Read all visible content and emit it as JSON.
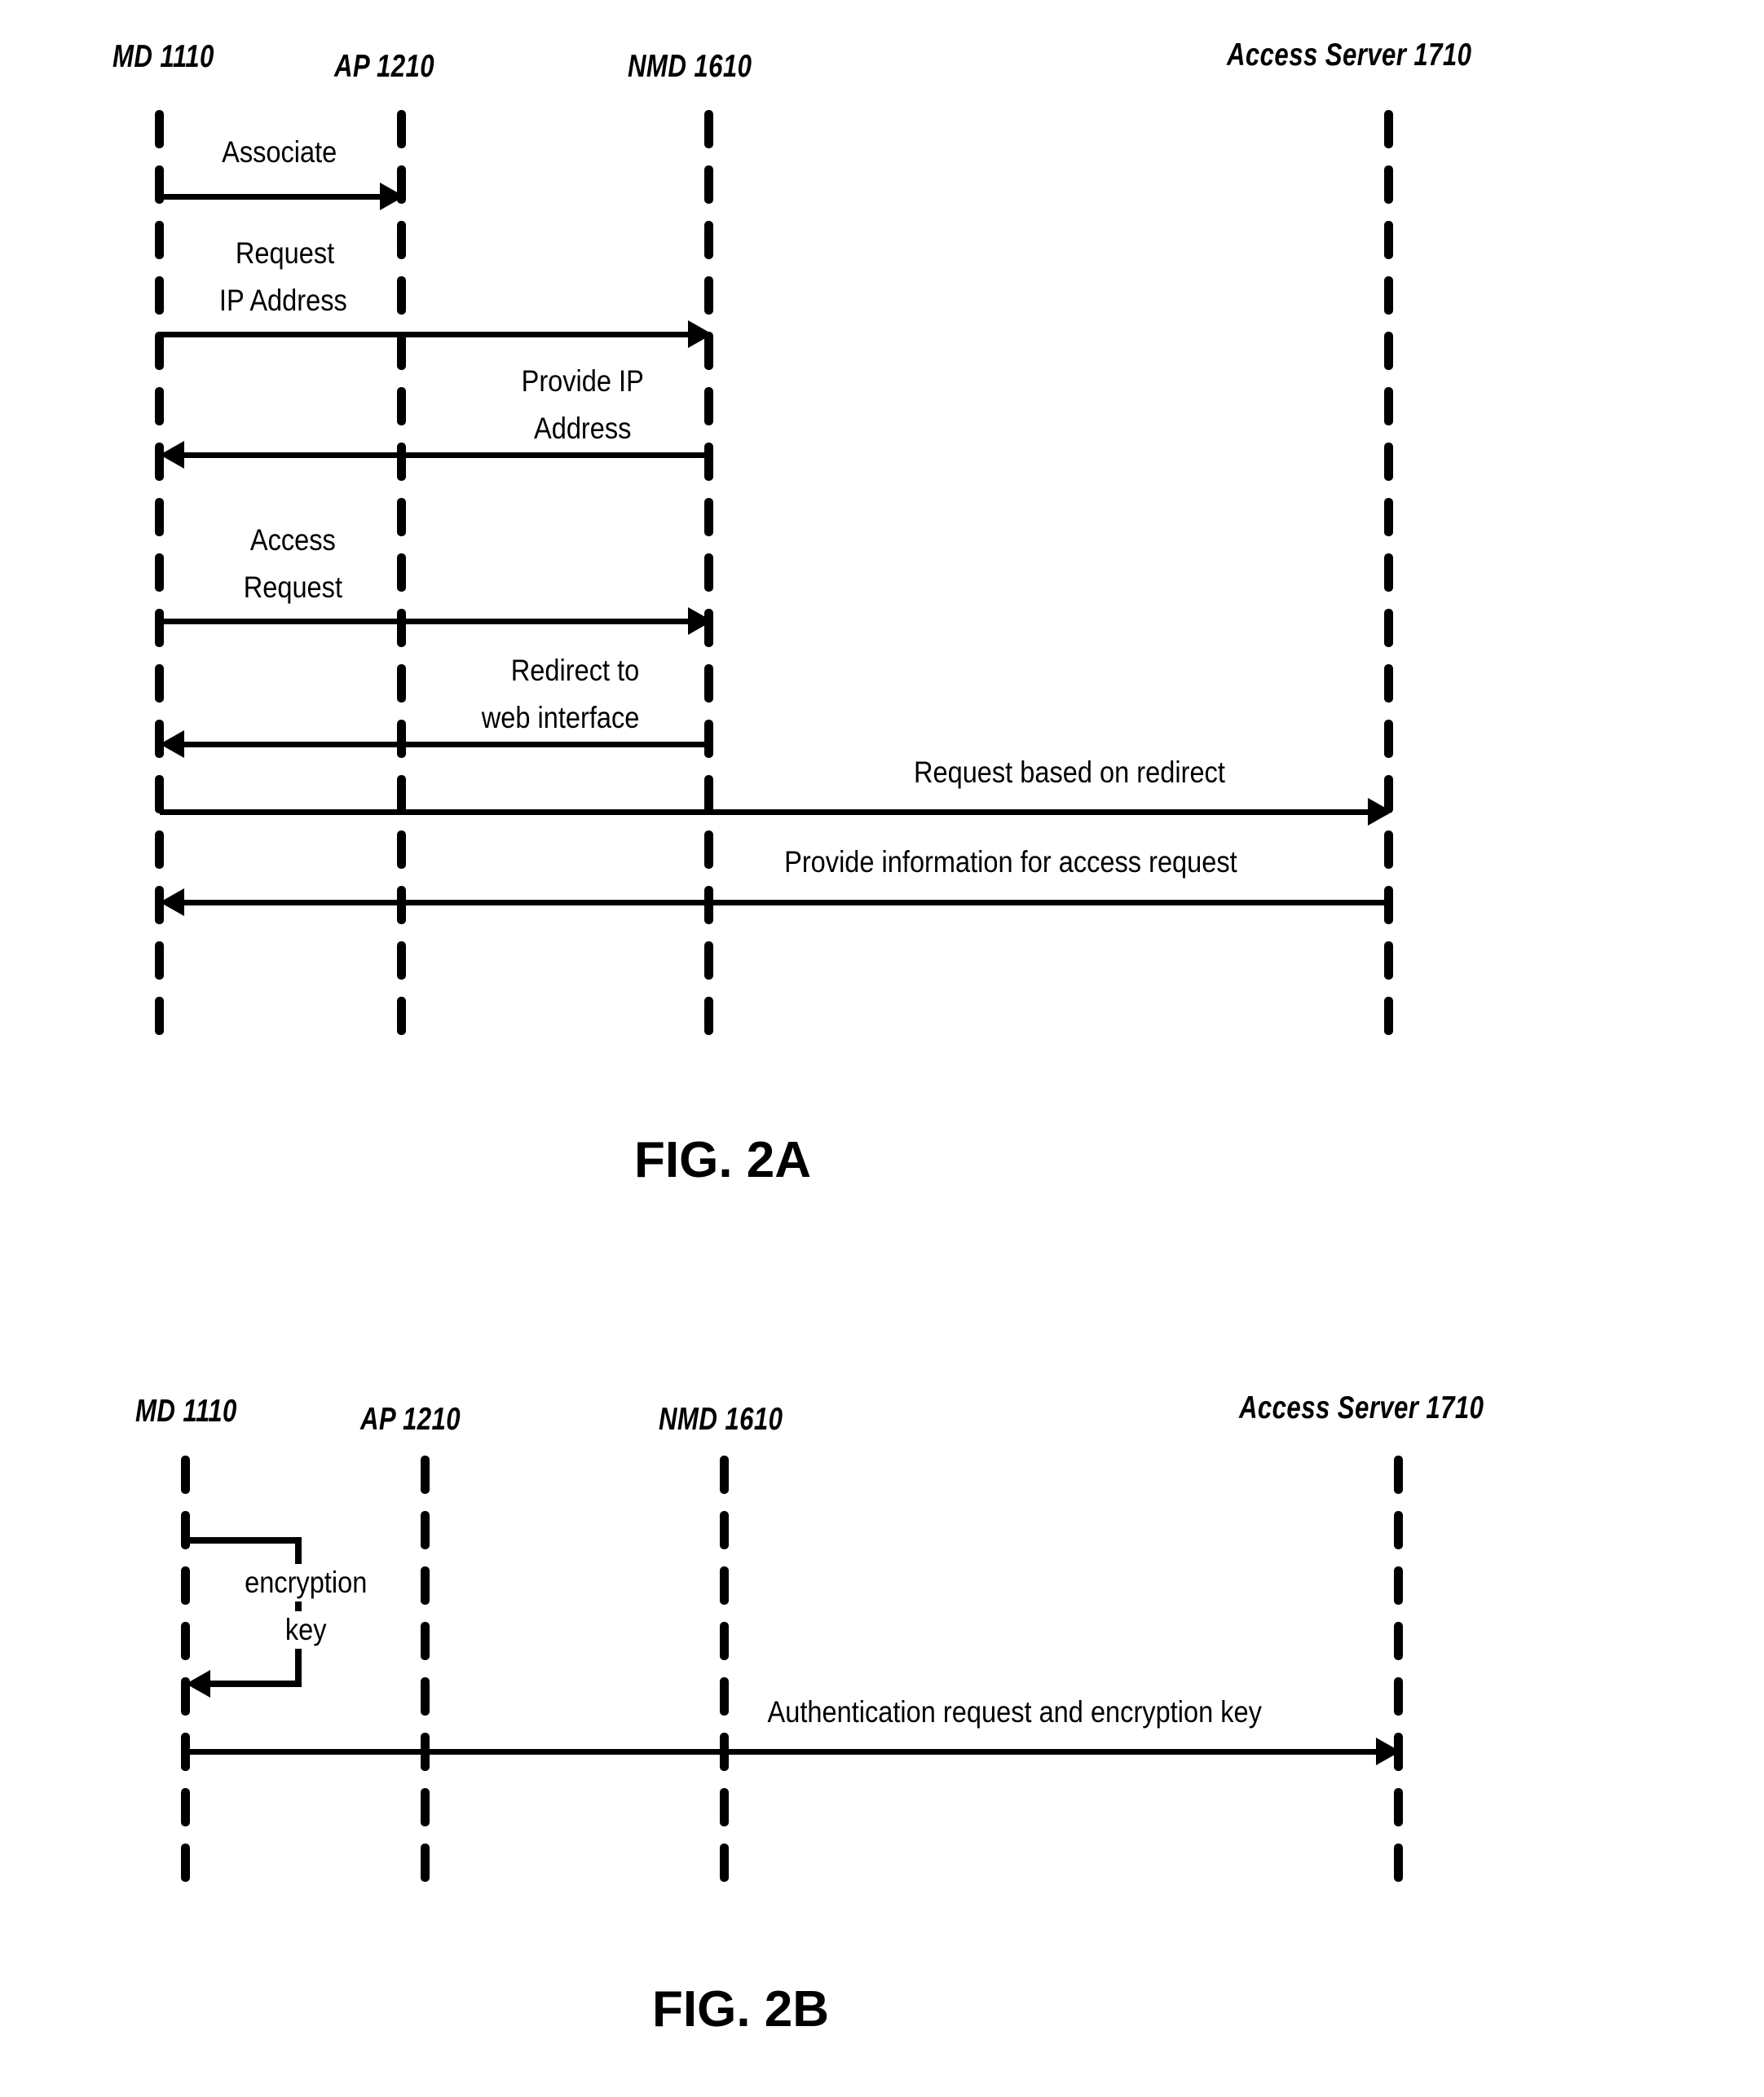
{
  "figures": [
    {
      "id": "fig-2a",
      "caption": "FIG. 2A",
      "participants": [
        {
          "name": "MD 1110"
        },
        {
          "name": "AP 1210"
        },
        {
          "name": "NMD 1610"
        },
        {
          "name": "Access Server 1710"
        }
      ],
      "messages": [
        {
          "label": "Associate",
          "from": "MD 1110",
          "to": "AP 1210",
          "direction": "right"
        },
        {
          "label_line1": "Request",
          "label_line2": "IP Address",
          "from": "MD 1110",
          "to": "NMD 1610",
          "direction": "right"
        },
        {
          "label_line1": "Provide IP",
          "label_line2": "Address",
          "from": "NMD 1610",
          "to": "MD 1110",
          "direction": "left"
        },
        {
          "label_line1": "Access",
          "label_line2": "Request",
          "from": "MD 1110",
          "to": "NMD 1610",
          "direction": "right"
        },
        {
          "label_line1": "Redirect to",
          "label_line2": "web interface",
          "from": "NMD 1610",
          "to": "MD 1110",
          "direction": "left"
        },
        {
          "label": "Request based on redirect",
          "from": "MD 1110",
          "to": "Access Server 1710",
          "direction": "right"
        },
        {
          "label": "Provide information for access request",
          "from": "Access Server 1710",
          "to": "MD 1110",
          "direction": "left"
        }
      ]
    },
    {
      "id": "fig-2b",
      "caption": "FIG. 2B",
      "participants": [
        {
          "name": "MD 1110"
        },
        {
          "name": "AP 1210"
        },
        {
          "name": "NMD 1610"
        },
        {
          "name": "Access Server 1710"
        }
      ],
      "messages": [
        {
          "label_line1": "encryption",
          "label_line2": "key",
          "from": "MD 1110",
          "to": "MD 1110",
          "direction": "self"
        },
        {
          "label": "Authentication request and encryption key",
          "from": "MD 1110",
          "to": "Access Server 1710",
          "direction": "right"
        }
      ]
    }
  ],
  "colors": {
    "ink": "#000000",
    "background": "#ffffff"
  }
}
